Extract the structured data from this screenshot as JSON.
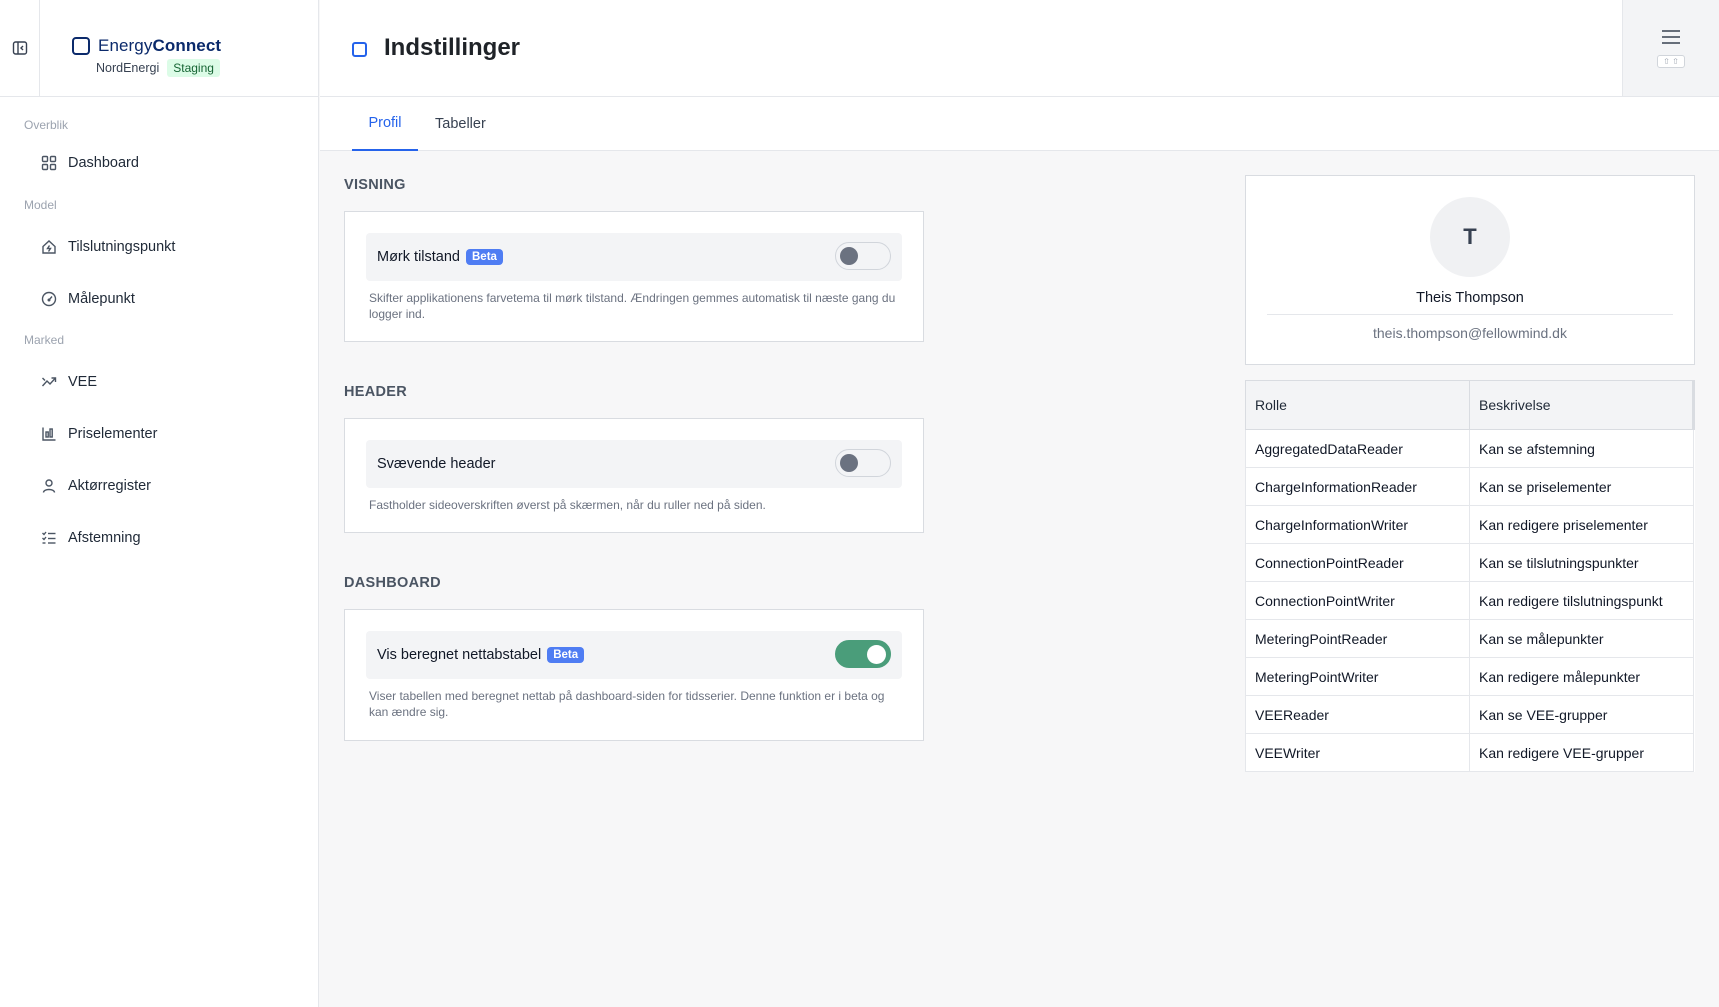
{
  "brand": {
    "prefix": "Energy",
    "suffix": "Connect",
    "org": "NordEnergi",
    "env": "Staging"
  },
  "sidebar": {
    "sections": [
      {
        "label": "Overblik",
        "items": [
          {
            "label": "Dashboard",
            "icon": "grid-icon"
          }
        ]
      },
      {
        "label": "Model",
        "items": [
          {
            "label": "Tilslutningspunkt",
            "icon": "home-plug-icon"
          },
          {
            "label": "Målepunkt",
            "icon": "gauge-icon"
          }
        ]
      },
      {
        "label": "Marked",
        "items": [
          {
            "label": "VEE",
            "icon": "trend-icon"
          },
          {
            "label": "Priselementer",
            "icon": "bar-chart-icon"
          },
          {
            "label": "Aktørregister",
            "icon": "user-icon"
          },
          {
            "label": "Afstemning",
            "icon": "checklist-icon"
          }
        ]
      }
    ]
  },
  "header": {
    "title": "Indstillinger",
    "menu_shortcut": "⇧ ⇧"
  },
  "tabs": [
    {
      "label": "Profil",
      "active": true
    },
    {
      "label": "Tabeller",
      "active": false
    }
  ],
  "settings": {
    "visning": {
      "title": "VISNING",
      "label": "Mørk tilstand",
      "badge": "Beta",
      "enabled": false,
      "description": "Skifter applikationens farvetema til mørk tilstand. Ændringen gemmes automatisk til næste gang du logger ind."
    },
    "header": {
      "title": "HEADER",
      "label": "Svævende header",
      "enabled": false,
      "description": "Fastholder sideoverskriften øverst på skærmen, når du ruller ned på siden."
    },
    "dashboard": {
      "title": "DASHBOARD",
      "label": "Vis beregnet nettabstabel",
      "badge": "Beta",
      "enabled": true,
      "description": "Viser tabellen med beregnet nettab på dashboard-siden for tidsserier. Denne funktion er i beta og kan ændre sig."
    }
  },
  "profile": {
    "initial": "T",
    "name": "Theis Thompson",
    "email": "theis.thompson@fellowmind.dk"
  },
  "roles": {
    "headers": [
      "Rolle",
      "Beskrivelse"
    ],
    "rows": [
      [
        "AggregatedDataReader",
        "Kan se afstemning"
      ],
      [
        "ChargeInformationReader",
        "Kan se priselementer"
      ],
      [
        "ChargeInformationWriter",
        "Kan redigere priselementer"
      ],
      [
        "ConnectionPointReader",
        "Kan se tilslutningspunkter"
      ],
      [
        "ConnectionPointWriter",
        "Kan redigere tilslutningspunkt"
      ],
      [
        "MeteringPointReader",
        "Kan se målepunkter"
      ],
      [
        "MeteringPointWriter",
        "Kan redigere målepunkter"
      ],
      [
        "VEEReader",
        "Kan se VEE-grupper"
      ],
      [
        "VEEWriter",
        "Kan redigere VEE-grupper"
      ]
    ]
  },
  "colors": {
    "accent": "#2563eb",
    "brand": "#0b2a6b",
    "toggle_on": "#4a9d7a",
    "beta": "#4f7df3"
  }
}
